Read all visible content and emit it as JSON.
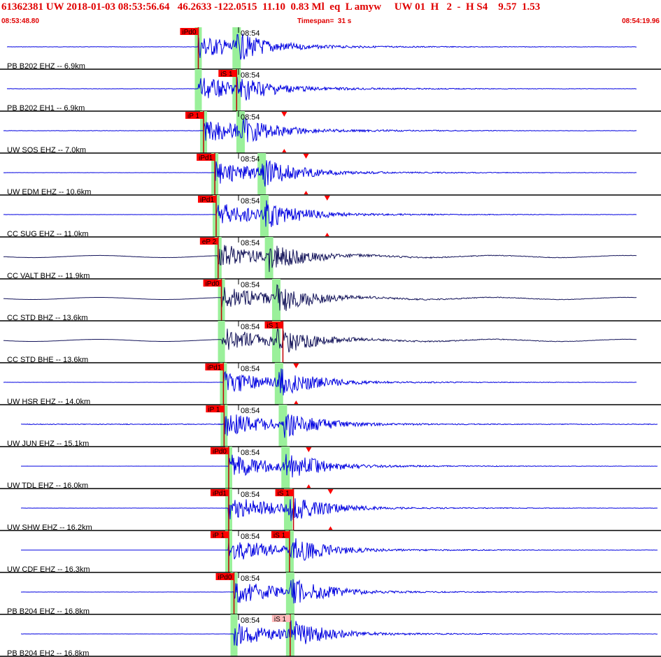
{
  "header": {
    "title": "61362381 UW 2018-01-03 08:53:56.64   46.2633 -122.0515  11.10  0.83 Ml  eq  L amyw     UW 01  H   2  -  H S4    9.57  1.53",
    "start_time": "08:53:48.80",
    "timespan": "Timespan=  31 s",
    "end_time": "08:54:19.96"
  },
  "colors": {
    "accent": "#e00000",
    "trace_blue": "#0000e0",
    "trace_dark": "#14145a",
    "pick_fill": "#ff0000",
    "pick_fill_light": "#ffbbbb",
    "window_green": "#9af09a"
  },
  "channels": [
    {
      "label": "PB B202 EHZ --  6.9km",
      "tick": "08:54",
      "trace_color": "#0000e0",
      "amp": 0.25,
      "p_time": 0.3,
      "s_time": 0.358,
      "picks": [
        {
          "label": "iPd0",
          "time": 0.3,
          "arrow": false
        }
      ]
    },
    {
      "label": "PB B202 EH1 --  6.9km",
      "tick": "08:54",
      "trace_color": "#0000e0",
      "amp": 0.2,
      "p_time": 0.3,
      "s_time": 0.358,
      "picks": [
        {
          "label": "iS 1",
          "time": 0.358,
          "arrow": false
        }
      ]
    },
    {
      "label": "UW SOS EHZ --  7.0km",
      "tick": "08:54",
      "trace_color": "#0000e0",
      "amp": 0.25,
      "p_time": 0.308,
      "s_time": 0.364,
      "picks": [
        {
          "label": "iP 1",
          "time": 0.308,
          "arrow": false
        },
        {
          "label": "",
          "time": 0.43,
          "arrow": true
        }
      ]
    },
    {
      "label": "UW EDM EHZ --  10.6km",
      "tick": "08:54",
      "trace_color": "#0000e0",
      "amp": 0.1,
      "p_time": 0.325,
      "s_time": 0.396,
      "picks": [
        {
          "label": "iPd1",
          "time": 0.325,
          "arrow": false
        },
        {
          "label": "",
          "time": 0.463,
          "arrow": true
        }
      ]
    },
    {
      "label": "CC SUG EHZ --  11.0km",
      "tick": "08:54",
      "trace_color": "#0000e0",
      "amp": 0.15,
      "p_time": 0.327,
      "s_time": 0.4,
      "picks": [
        {
          "label": "iPd1",
          "time": 0.327,
          "arrow": false
        },
        {
          "label": "",
          "time": 0.495,
          "arrow": true
        }
      ]
    },
    {
      "label": "CC VALT BHZ --  11.9km",
      "tick": "08:54",
      "trace_color": "#14145a",
      "amp": 0.12,
      "p_time": 0.33,
      "s_time": 0.407,
      "picks": [
        {
          "label": "eP 2",
          "time": 0.33,
          "arrow": false
        }
      ]
    },
    {
      "label": "CC STD BHZ --  13.6km",
      "tick": "08:54",
      "trace_color": "#14145a",
      "amp": 0.05,
      "p_time": 0.335,
      "s_time": 0.418,
      "picks": [
        {
          "label": "iPd0",
          "time": 0.335,
          "arrow": false
        }
      ]
    },
    {
      "label": "CC STD BHE --  13.6km",
      "tick": "08:54",
      "trace_color": "#14145a",
      "amp": 0.05,
      "p_time": 0.335,
      "s_time": 0.418,
      "picks": [
        {
          "label": "iS 1",
          "time": 0.428,
          "arrow": false
        }
      ]
    },
    {
      "label": "UW HSR EHZ --  14.0km",
      "tick": "08:54",
      "trace_color": "#0000e0",
      "amp": 0.1,
      "p_time": 0.338,
      "s_time": 0.422,
      "picks": [
        {
          "label": "iPd1",
          "time": 0.338,
          "arrow": false
        },
        {
          "label": "",
          "time": 0.448,
          "arrow": true
        }
      ]
    },
    {
      "label": "UW JUN EHZ --  15.1km",
      "tick": "08:54",
      "trace_color": "#0000e0",
      "amp": 0.55,
      "p_time": 0.339,
      "s_time": 0.428,
      "picks": [
        {
          "label": "iP 1",
          "time": 0.339,
          "arrow": false
        }
      ]
    },
    {
      "label": "UW TDL EHZ --  16.0km",
      "tick": "08:54",
      "trace_color": "#0000e0",
      "amp": 0.06,
      "p_time": 0.346,
      "s_time": 0.432,
      "picks": [
        {
          "label": "iPd0",
          "time": 0.346,
          "arrow": false
        },
        {
          "label": "",
          "time": 0.467,
          "arrow": true
        }
      ]
    },
    {
      "label": "UW SHW EHZ --  16.2km",
      "tick": "08:54",
      "trace_color": "#0000e0",
      "amp": 0.15,
      "p_time": 0.346,
      "s_time": 0.436,
      "picks": [
        {
          "label": "iPd1",
          "time": 0.346,
          "arrow": false
        },
        {
          "label": "iS 1",
          "time": 0.444,
          "arrow": false
        },
        {
          "label": "",
          "time": 0.5,
          "arrow": true
        }
      ]
    },
    {
      "label": "UW CDF EHZ --  16.3km",
      "tick": "08:54",
      "trace_color": "#0000e0",
      "amp": 0.04,
      "p_time": 0.346,
      "s_time": 0.438,
      "picks": [
        {
          "label": "iP 1",
          "time": 0.346,
          "arrow": false
        },
        {
          "label": "iS 1",
          "time": 0.438,
          "arrow": false
        }
      ]
    },
    {
      "label": "PB B204 EHZ --  16.8km",
      "tick": "08:54",
      "trace_color": "#0000e0",
      "amp": 0.15,
      "p_time": 0.354,
      "s_time": 0.439,
      "picks": [
        {
          "label": "iPd0",
          "time": 0.354,
          "arrow": false
        }
      ]
    },
    {
      "label": "PB B204 EH2 --  16.8km",
      "tick": "08:54",
      "trace_color": "#0000e0",
      "amp": 0.12,
      "p_time": 0.354,
      "s_time": 0.439,
      "picks": [
        {
          "label": "iS 1",
          "time": 0.439,
          "arrow": false,
          "light": true
        }
      ]
    }
  ]
}
